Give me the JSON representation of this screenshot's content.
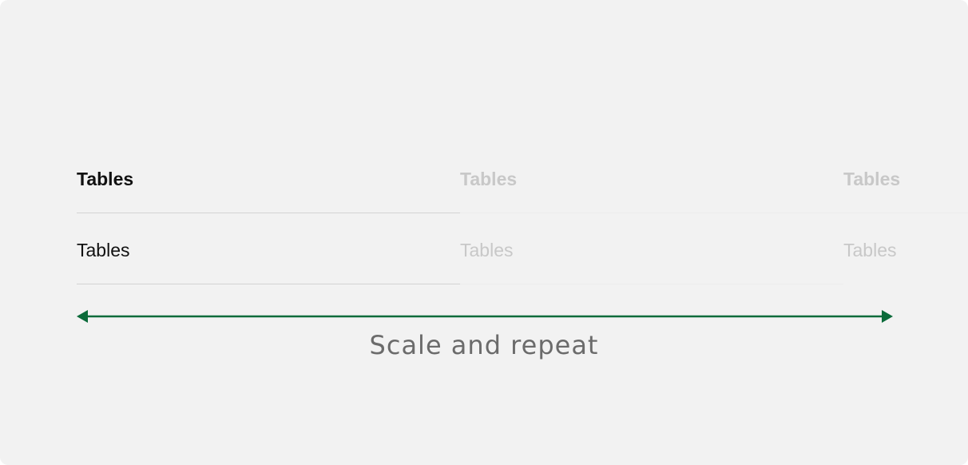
{
  "columns": [
    {
      "header": "Tables",
      "row": "Tables",
      "emphasis": "primary"
    },
    {
      "header": "Tables",
      "row": "Tables",
      "emphasis": "faded"
    },
    {
      "header": "Tables",
      "row": "Tables",
      "emphasis": "faded"
    }
  ],
  "arrow": {
    "color": "#0b6b3a",
    "direction": "double-headed",
    "icon": "double-arrow-icon"
  },
  "caption": "Scale and repeat",
  "colors": {
    "background": "#f2f2f2",
    "primary_text": "#111111",
    "faded_text": "#c8c8c8",
    "caption_text": "#6b6b6b",
    "arrow": "#0b6b3a"
  }
}
